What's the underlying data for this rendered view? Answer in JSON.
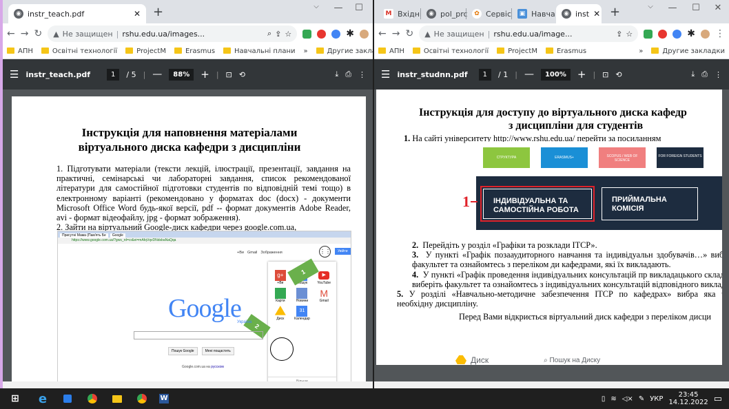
{
  "left_window": {
    "tab_title": "instr_teach.pdf",
    "address_warning": "Не защищен",
    "address_url": "rshu.edu.ua/images...",
    "bookmarks": [
      "АПН",
      "Освітні технології",
      "ProjectM",
      "Erasmus",
      "Навчальні плани"
    ],
    "bookmarks_other": "Другие заклад",
    "pdf": {
      "filename": "instr_teach.pdf",
      "page_current": "1",
      "page_total": "/ 5",
      "zoom": "88%",
      "title_line1": "Інструкція для наповнення матеріалами",
      "title_line2": "віртуального диска кафедри з дисципліни",
      "step1": "1. Підготувати матеріали (тексти лекцій, ілюстрації, презентації, завдання на практичні, семінарські чи лабораторні завдання, список рекомендованої літератури для самостійної підготовки студентів по відповідній темі тощо) в електронному варіанті (рекомендовано у форматах doc (docx) - документи Microsoft Office Word будь-якої версії, pdf -- формат документів Adobe Reader, avi - формат відеофайлу, jpg - формат зображення).",
      "step2": "2. Зайти на віртуальний Google-диск кафедри через google.com.ua,",
      "screenshot": {
        "tab_a": "Присутні Мама (Пам'ять Бе",
        "tab_b": "Google",
        "url": "https://www.google.com.ua/?gws_rd=cr&ei=mAfqVqvDNdsbaNaQqa",
        "top_links": [
          "+Ви",
          "Gmail",
          "Зображення"
        ],
        "signin": "Увійти",
        "logo": "Google",
        "logo_sub": "Україна",
        "apps": [
          "+Ви",
          "Пошук",
          "YouTube",
          "Карти",
          "Новини",
          "Gmail",
          "Диск",
          "Календар"
        ],
        "more": "Більше",
        "btn_search": "Пошук Google",
        "btn_lucky": "Мені пощастить",
        "footer": "Google.com.ua на",
        "footer_link": "русском",
        "callout1": "1",
        "callout2": "2"
      }
    }
  },
  "right_window": {
    "tabs": [
      "Вхідні",
      "pol_prc",
      "Сервіс",
      "Навча",
      "inst"
    ],
    "address_warning": "Не защищен",
    "address_url": "rshu.edu.ua/image...",
    "bookmarks": [
      "АПН",
      "Освітні технології",
      "ProjectM",
      "Erasmus"
    ],
    "bookmarks_other": "Другие закладки",
    "pdf": {
      "filename": "instr_studnn.pdf",
      "page_current": "1",
      "page_total": "/ 1",
      "zoom": "100%",
      "title_line1": "Інструкція для доступу до віртуального диска кафедр",
      "title_line2": "з дисципліни для студентів",
      "step1": "На сайті університету http://www.rshu.edu.ua/ перейти за посиланням",
      "banner": {
        "buttons": [
          "СТРУКТУРА",
          "ERASMUS+",
          "SCOPUS / WEB OF SCIENCE",
          "FOR FOREIGN STUDENTS"
        ],
        "box_left_line1": "ІНДИВІДУАЛЬНА ТА",
        "box_left_line2": "САМОСТІЙНА РОБОТА",
        "box_right_line1": "ПРИЙМАЛЬНА",
        "box_right_line2": "КОМІСІЯ",
        "marker": "1"
      },
      "step2": "Перейдіть у розділ «Графіки та розклади ІТСР».",
      "step3": "У пункті «Графік позааудиторного навчання та індивідуальн здобувачів…» виберіть факультет та ознайомтесь з переліком ди кафедрами, які їх викладають.",
      "step4": "У пункті «Графік проведення індивідуальних консультацій пр викладацького складу…» виберіть факультет та ознайомтесь з індивідуальних консультацій відповідного викладача.",
      "step5": "У розділі «Навчально-методичне забезпечення ІТСР по кафедрах» вибра яка читає необхідну дисципліну.",
      "last_line": "Перед Вами відкриється віртуальний диск кафедри з переліком дисци",
      "drive_label": "Диск",
      "drive_search": "Пошук на Диску"
    }
  },
  "taskbar": {
    "lang": "УКР",
    "time": "23:45",
    "date": "14.12.2022"
  }
}
